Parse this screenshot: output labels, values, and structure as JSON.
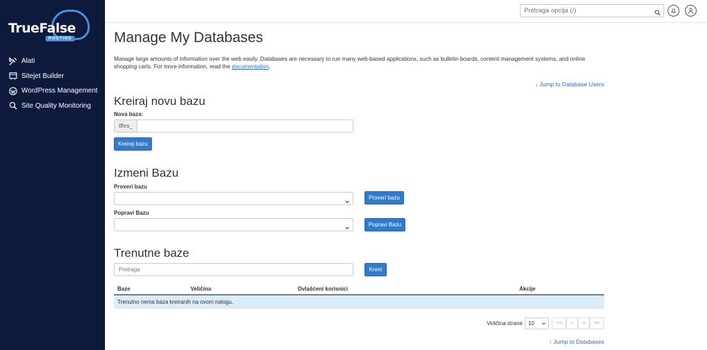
{
  "brand": {
    "name_part1": "True",
    "name_part2": "False",
    "sub": "HOSTING"
  },
  "sidebar": {
    "items": [
      {
        "label": "Alati",
        "icon": "tools-icon"
      },
      {
        "label": "Sitejet Builder",
        "icon": "sitejet-icon"
      },
      {
        "label": "WordPress Management",
        "icon": "wordpress-icon"
      },
      {
        "label": "Site Quality Monitoring",
        "icon": "magnifier-icon"
      }
    ]
  },
  "topbar": {
    "search_placeholder": "Pretraga opcija (/)"
  },
  "page": {
    "title": "Manage My Databases",
    "description": "Manage large amounts of information over the web easily. Databases are necessary to run many web-based applications, such as bulletin boards, content management systems, and online shopping carts. For more information, read the",
    "doc_link": "documentation",
    "desc_end": ".",
    "jump_users": "Jump to Database Users",
    "jump_databases": "Jump to Databases"
  },
  "create": {
    "heading": "Kreiraj novu bazu",
    "label": "Nova baza:",
    "prefix": "tfhrs_",
    "value": "",
    "button": "Kreiraj bazu"
  },
  "modify": {
    "heading": "Izmeni Bazu",
    "check_label": "Proveri bazu",
    "check_button": "Proveri bazu",
    "repair_label": "Popravi Bazu",
    "repair_button": "Popravi Bazu"
  },
  "current": {
    "heading": "Trenutne baze",
    "search_placeholder": "Pretraga",
    "go_button": "Kreni",
    "columns": [
      "Baze",
      "Veličina",
      "Ovlašćeni korisnici",
      "Akcije"
    ],
    "empty_message": "Trenutno nema baza kreiranih na ovom nalogu."
  },
  "pager": {
    "label": "Veličina strane",
    "page_size": "10",
    "first": "<<",
    "prev": "<",
    "next": ">",
    "last": ">>"
  },
  "colors": {
    "sidebar": "#0d1a3c",
    "accent": "#2f7ccc",
    "link": "#2a6fbf",
    "empty_row": "#d9ecf7"
  }
}
